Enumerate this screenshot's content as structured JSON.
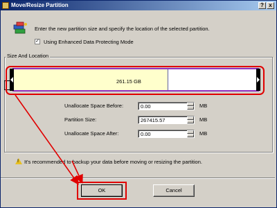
{
  "window": {
    "title": "Move/Resize Partition",
    "help_label": "?",
    "close_label": "x"
  },
  "header": {
    "instruction": "Enter the new partition size and specify the location of the selected partition."
  },
  "options": {
    "enhanced_protect_label": "Using Enhanced Data Protecting Mode",
    "enhanced_protect_checked": true,
    "check_mark": "✓"
  },
  "group": {
    "label": "Size And Location"
  },
  "partition_bar": {
    "size_label": "261.15 GB",
    "used_fraction": 0.63
  },
  "fields": [
    {
      "label": "Unallocate Space Before:",
      "value": "0.00",
      "unit": "MB"
    },
    {
      "label": "Partition Size:",
      "value": "267415.57",
      "unit": "MB"
    },
    {
      "label": "Unallocate Space After:",
      "value": "0.00",
      "unit": "MB"
    }
  ],
  "tip": {
    "text": "It's recommended to backup your data before moving or resizing the partition."
  },
  "buttons": {
    "ok": "OK",
    "cancel": "Cancel"
  },
  "colors": {
    "highlight": "#e00000",
    "title_start": "#0a246a",
    "bar_fill": "#ffffcc",
    "bar_border": "#9030c0"
  }
}
